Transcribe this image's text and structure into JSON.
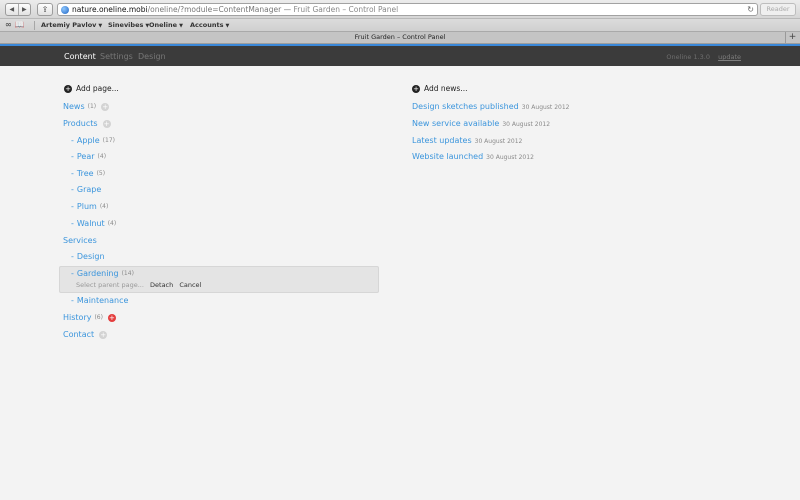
{
  "browser": {
    "back_glyph": "◀",
    "forward_glyph": "▶",
    "share_glyph": "⇪",
    "url_host": "nature.oneline.mobi",
    "url_path": "/oneline/?module=ContentManager",
    "url_separator": "—",
    "page_title": "Fruit Garden – Control Panel",
    "reload_glyph": "↻",
    "reader_label": "Reader",
    "bookmark_icons": "∞ 📖",
    "bookmarks": [
      {
        "label": "Artemiy Pavlov",
        "caret": "▼"
      },
      {
        "label": "Sinevibes",
        "caret": "▼"
      },
      {
        "label": "Oneline",
        "caret": "▼"
      },
      {
        "label": "Accounts",
        "caret": "▼"
      }
    ],
    "tab_title": "Fruit Garden – Control Panel",
    "new_tab_glyph": "+"
  },
  "app": {
    "nav": [
      {
        "label": "Content"
      },
      {
        "label": "Settings"
      },
      {
        "label": "Design"
      }
    ],
    "version": "Oneline 1.3.0",
    "update": "update",
    "accent": "#3a88d9"
  },
  "pages": {
    "add_label": "Add page...",
    "plus_glyph": "+",
    "dash": "-",
    "items": [
      {
        "label": "News",
        "count": "(1)"
      },
      {
        "label": "Products",
        "count": ""
      },
      {
        "label": "Apple",
        "count": "(17)"
      },
      {
        "label": "Pear",
        "count": "(4)"
      },
      {
        "label": "Tree",
        "count": "(5)"
      },
      {
        "label": "Grape",
        "count": ""
      },
      {
        "label": "Plum",
        "count": "(4)"
      },
      {
        "label": "Walnut",
        "count": "(4)"
      },
      {
        "label": "Services",
        "count": ""
      },
      {
        "label": "Design",
        "count": ""
      },
      {
        "label": "Gardening",
        "count": "(14)"
      },
      {
        "label": "Maintenance",
        "count": ""
      },
      {
        "label": "History",
        "count": "(6)"
      },
      {
        "label": "Contact",
        "count": ""
      }
    ],
    "selected_actions": {
      "select_parent": "Select parent page...",
      "detach": "Detach",
      "cancel": "Cancel"
    }
  },
  "news": {
    "add_label": "Add news...",
    "items": [
      {
        "title": "Design sketches published",
        "date": "30 August 2012"
      },
      {
        "title": "New service available",
        "date": "30 August 2012"
      },
      {
        "title": "Latest updates",
        "date": "30 August 2012"
      },
      {
        "title": "Website launched",
        "date": "30 August 2012"
      }
    ]
  }
}
